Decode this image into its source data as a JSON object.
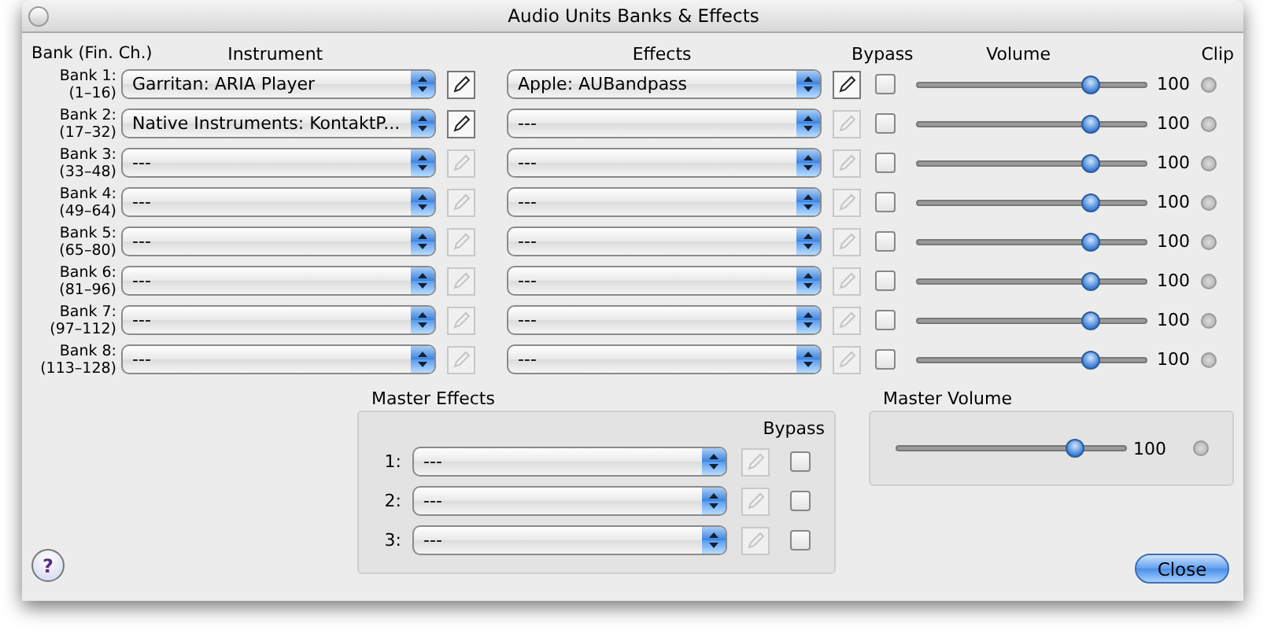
{
  "window": {
    "title": "Audio Units Banks & Effects"
  },
  "headers": {
    "bank": "Bank (Fin. Ch.)",
    "instrument": "Instrument",
    "effects": "Effects",
    "bypass": "Bypass",
    "volume": "Volume",
    "clip": "Clip"
  },
  "banks": [
    {
      "label": "Bank 1:",
      "range": "(1–16)",
      "instrument": {
        "value": "Garritan: ARIA Player",
        "editable": true
      },
      "effect": {
        "value": "Apple: AUBandpass",
        "editable": true
      },
      "bypass": false,
      "level": 0.78,
      "reading": "100"
    },
    {
      "label": "Bank 2:",
      "range": "(17–32)",
      "instrument": {
        "value": "Native Instruments: KontaktP...",
        "editable": true
      },
      "effect": {
        "value": "---",
        "editable": false
      },
      "bypass": false,
      "level": 0.78,
      "reading": "100"
    },
    {
      "label": "Bank 3:",
      "range": "(33–48)",
      "instrument": {
        "value": "---",
        "editable": false
      },
      "effect": {
        "value": "---",
        "editable": false
      },
      "bypass": false,
      "level": 0.78,
      "reading": "100"
    },
    {
      "label": "Bank 4:",
      "range": "(49–64)",
      "instrument": {
        "value": "---",
        "editable": false
      },
      "effect": {
        "value": "---",
        "editable": false
      },
      "bypass": false,
      "level": 0.78,
      "reading": "100"
    },
    {
      "label": "Bank 5:",
      "range": "(65–80)",
      "instrument": {
        "value": "---",
        "editable": false
      },
      "effect": {
        "value": "---",
        "editable": false
      },
      "bypass": false,
      "level": 0.78,
      "reading": "100"
    },
    {
      "label": "Bank 6:",
      "range": "(81–96)",
      "instrument": {
        "value": "---",
        "editable": false
      },
      "effect": {
        "value": "---",
        "editable": false
      },
      "bypass": false,
      "level": 0.78,
      "reading": "100"
    },
    {
      "label": "Bank 7:",
      "range": "(97–112)",
      "instrument": {
        "value": "---",
        "editable": false
      },
      "effect": {
        "value": "---",
        "editable": false
      },
      "bypass": false,
      "level": 0.78,
      "reading": "100"
    },
    {
      "label": "Bank 8:",
      "range": "(113–128)",
      "instrument": {
        "value": "---",
        "editable": false
      },
      "effect": {
        "value": "---",
        "editable": false
      },
      "bypass": false,
      "level": 0.78,
      "reading": "100"
    }
  ],
  "master_effects": {
    "title": "Master Effects",
    "bypass_header": "Bypass",
    "slots": [
      {
        "label": "1:",
        "value": "---",
        "editable": false,
        "bypass": false
      },
      {
        "label": "2:",
        "value": "---",
        "editable": false,
        "bypass": false
      },
      {
        "label": "3:",
        "value": "---",
        "editable": false,
        "bypass": false
      }
    ]
  },
  "master_volume": {
    "title": "Master Volume",
    "level": 0.8,
    "reading": "100"
  },
  "help_button": "?",
  "close_button": "Close"
}
